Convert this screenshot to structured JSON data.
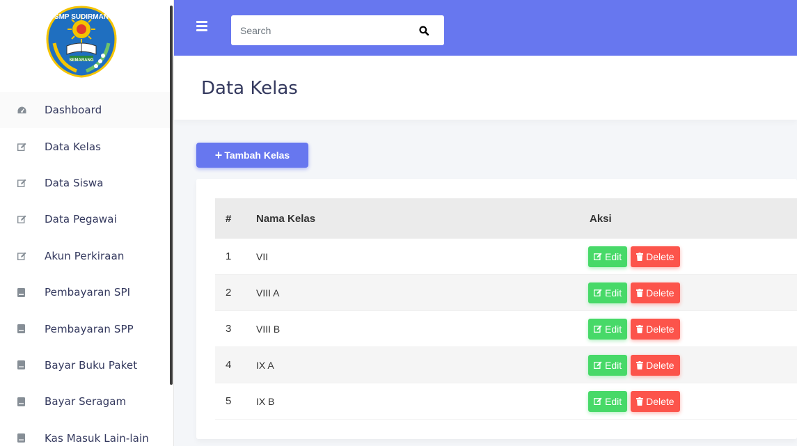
{
  "logo": {
    "top_text": "SMP SUDIRMAN",
    "bottom_text": "SEMARANG"
  },
  "search": {
    "placeholder": "Search"
  },
  "sidebar": {
    "items": [
      {
        "label": "Dashboard",
        "icon": "dashboard-icon"
      },
      {
        "label": "Data Kelas",
        "icon": "edit-icon"
      },
      {
        "label": "Data Siswa",
        "icon": "edit-icon"
      },
      {
        "label": "Data Pegawai",
        "icon": "edit-icon"
      },
      {
        "label": "Akun Perkiraan",
        "icon": "edit-icon"
      },
      {
        "label": "Pembayaran SPI",
        "icon": "book-icon"
      },
      {
        "label": "Pembayaran SPP",
        "icon": "book-icon"
      },
      {
        "label": "Bayar Buku Paket",
        "icon": "book-icon"
      },
      {
        "label": "Bayar Seragam",
        "icon": "book-icon"
      },
      {
        "label": "Kas Masuk Lain-lain",
        "icon": "book-icon"
      }
    ]
  },
  "page": {
    "title": "Data Kelas",
    "add_button": "Tambah Kelas"
  },
  "table": {
    "headers": [
      "#",
      "Nama Kelas",
      "Aksi"
    ],
    "rows": [
      {
        "no": "1",
        "nama": "VII"
      },
      {
        "no": "2",
        "nama": "VIII A"
      },
      {
        "no": "3",
        "nama": "VIII B"
      },
      {
        "no": "4",
        "nama": "IX A"
      },
      {
        "no": "5",
        "nama": "IX B"
      }
    ],
    "edit_label": "Edit",
    "delete_label": "Delete"
  },
  "colors": {
    "primary": "#6777ef",
    "success": "#47d968",
    "danger": "#fc544b"
  }
}
